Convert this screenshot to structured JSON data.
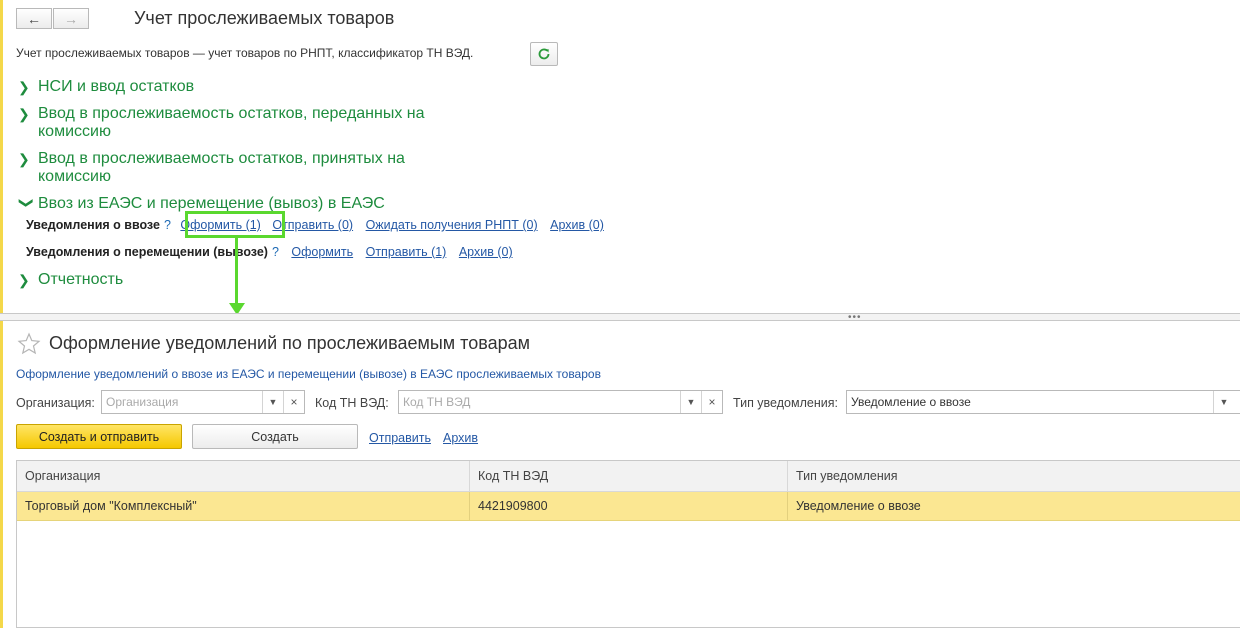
{
  "top": {
    "title": "Учет прослеживаемых товаров",
    "subtitle": "Учет прослеживаемых товаров — учет товаров по РНПТ, классификатор ТН ВЭД.",
    "nav_back": "←",
    "nav_forward": "→",
    "groups": [
      {
        "label": "НСИ и ввод остатков",
        "expanded": false
      },
      {
        "label": "Ввод в прослеживаемость остатков, переданных на комиссию",
        "expanded": false
      },
      {
        "label": "Ввод в прослеживаемость остатков, принятых на комиссию",
        "expanded": false
      },
      {
        "label": "Ввоз из ЕАЭС и перемещение (вывоз) в ЕАЭС",
        "expanded": true
      },
      {
        "label": "Отчетность",
        "expanded": false
      }
    ],
    "import_row": {
      "label": "Уведомления о ввозе",
      "help": "?",
      "links": [
        "Оформить (1)",
        "Отправить (0)",
        "Ожидать получения РНПТ (0)",
        "Архив (0)"
      ]
    },
    "move_row": {
      "label": "Уведомления о перемещении (вывозе)",
      "help": "?",
      "links": [
        "Оформить",
        "Отправить (1)",
        "Архив (0)"
      ]
    }
  },
  "bottom": {
    "title": "Оформление уведомлений по прослеживаемым товарам",
    "subtitle": "Оформление уведомлений о ввозе из ЕАЭС и перемещении (вывозе) в ЕАЭС прослеживаемых товаров",
    "filters": {
      "org_label": "Организация:",
      "org_placeholder": "Организация",
      "code_label": "Код ТН ВЭД:",
      "code_placeholder": "Код ТН ВЭД",
      "type_label": "Тип уведомления:",
      "type_value": "Уведомление о ввозе"
    },
    "buttons": {
      "create_send": "Создать и отправить",
      "create": "Создать",
      "send": "Отправить",
      "archive": "Архив"
    },
    "table": {
      "columns": [
        "Организация",
        "Код ТН ВЭД",
        "Тип уведомления"
      ],
      "rows": [
        [
          "Торговый дом \"Комплексный\"",
          "4421909800",
          "Уведомление о ввозе"
        ]
      ]
    }
  },
  "colors": {
    "accent_green": "#1e8c3e",
    "link_blue": "#2458a5",
    "annotation_green": "#5ad82f",
    "selected_row": "#fbe792"
  }
}
